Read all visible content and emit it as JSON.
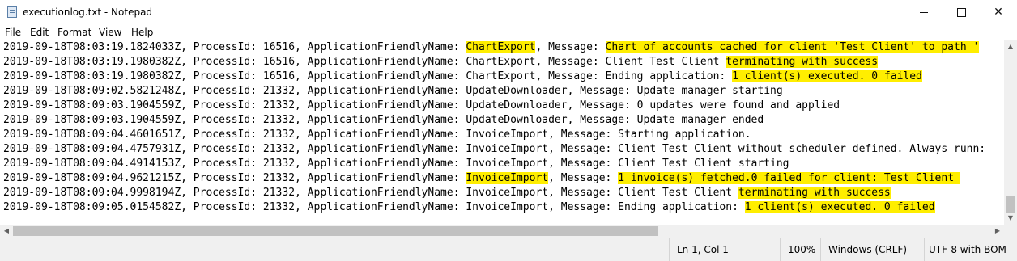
{
  "window": {
    "title": "executionlog.txt - Notepad",
    "icon": "notepad-icon",
    "controls": {
      "minimize": "minimize-icon",
      "maximize": "maximize-icon",
      "close": "✕"
    }
  },
  "menu": [
    "File",
    "Edit",
    "Format",
    "View",
    "Help"
  ],
  "highlight_color": "#ffee00",
  "lines": [
    {
      "segments": [
        {
          "text": "2019-09-18T08:03:19.1824033Z, ProcessId: 16516, ApplicationFriendlyName: "
        },
        {
          "text": "ChartExport",
          "hl": true
        },
        {
          "text": ", Message: "
        },
        {
          "text": "Chart of accounts cached for client 'Test Client' to path '",
          "hl": true
        }
      ]
    },
    {
      "segments": [
        {
          "text": "2019-09-18T08:03:19.1980382Z, ProcessId: 16516, ApplicationFriendlyName: ChartExport, Message: Client Test Client "
        },
        {
          "text": "terminating with success",
          "hl": true
        }
      ]
    },
    {
      "segments": [
        {
          "text": "2019-09-18T08:03:19.1980382Z, ProcessId: 16516, ApplicationFriendlyName: ChartExport, Message: Ending application: "
        },
        {
          "text": "1 client(s) executed. 0 failed",
          "hl": true
        }
      ]
    },
    {
      "segments": [
        {
          "text": "2019-09-18T08:09:02.5821248Z, ProcessId: 21332, ApplicationFriendlyName: UpdateDownloader, Message: Update manager starting"
        }
      ]
    },
    {
      "segments": [
        {
          "text": "2019-09-18T08:09:03.1904559Z, ProcessId: 21332, ApplicationFriendlyName: UpdateDownloader, Message: 0 updates were found and applied"
        }
      ]
    },
    {
      "segments": [
        {
          "text": "2019-09-18T08:09:03.1904559Z, ProcessId: 21332, ApplicationFriendlyName: UpdateDownloader, Message: Update manager ended"
        }
      ]
    },
    {
      "segments": [
        {
          "text": "2019-09-18T08:09:04.4601651Z, ProcessId: 21332, ApplicationFriendlyName: InvoiceImport, Message: Starting application."
        }
      ]
    },
    {
      "segments": [
        {
          "text": "2019-09-18T08:09:04.4757931Z, ProcessId: 21332, ApplicationFriendlyName: InvoiceImport, Message: Client Test Client without scheduler defined. Always runn:"
        }
      ]
    },
    {
      "segments": [
        {
          "text": "2019-09-18T08:09:04.4914153Z, ProcessId: 21332, ApplicationFriendlyName: InvoiceImport, Message: Client Test Client starting"
        }
      ]
    },
    {
      "segments": [
        {
          "text": "2019-09-18T08:09:04.9621215Z, ProcessId: 21332, ApplicationFriendlyName: "
        },
        {
          "text": "InvoiceImport",
          "hl": true
        },
        {
          "text": ", Message: "
        },
        {
          "text": "1 invoice(s) fetched.0 failed for client: Test Client ",
          "hl": true
        }
      ]
    },
    {
      "segments": [
        {
          "text": "2019-09-18T08:09:04.9998194Z, ProcessId: 21332, ApplicationFriendlyName: InvoiceImport, Message: Client Test Client "
        },
        {
          "text": "terminating with success",
          "hl": true
        }
      ]
    },
    {
      "segments": [
        {
          "text": "2019-09-18T08:09:05.0154582Z, ProcessId: 21332, ApplicationFriendlyName: InvoiceImport, Message: Ending application: "
        },
        {
          "text": "1 client(s) executed. 0 failed",
          "hl": true
        }
      ]
    }
  ],
  "status": {
    "position": "Ln 1, Col 1",
    "zoom": "100%",
    "line_ending": "Windows (CRLF)",
    "encoding": "UTF-8 with BOM"
  }
}
